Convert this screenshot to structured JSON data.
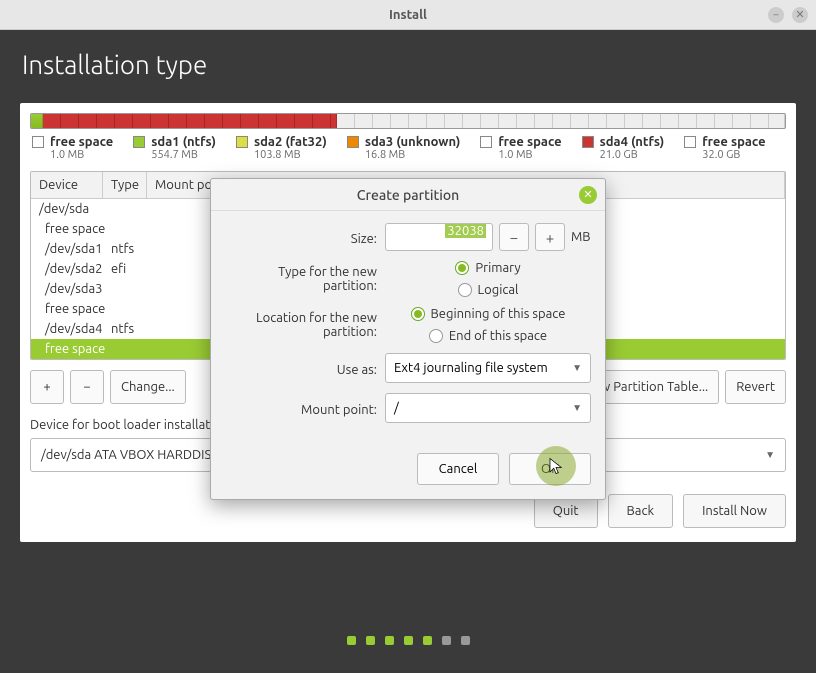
{
  "window": {
    "title": "Install"
  },
  "heading": "Installation type",
  "legend": [
    {
      "color": "lg-empty",
      "label": "free space",
      "sub": "1.0 MB"
    },
    {
      "color": "lg-green",
      "label": "sda1 (ntfs)",
      "sub": "554.7 MB"
    },
    {
      "color": "lg-yellow",
      "label": "sda2 (fat32)",
      "sub": "103.8 MB"
    },
    {
      "color": "lg-orange",
      "label": "sda3 (unknown)",
      "sub": "16.8 MB"
    },
    {
      "color": "lg-empty",
      "label": "free space",
      "sub": "1.0 MB"
    },
    {
      "color": "lg-red",
      "label": "sda4 (ntfs)",
      "sub": "21.0 GB"
    },
    {
      "color": "lg-empty",
      "label": "free space",
      "sub": "32.0 GB"
    }
  ],
  "table": {
    "headers": {
      "device": "Device",
      "type": "Type",
      "mount": "Mount point"
    },
    "rows": [
      {
        "device": "/dev/sda",
        "type": ""
      },
      {
        "device": "  free space",
        "type": ""
      },
      {
        "device": "  /dev/sda1",
        "type": "ntfs"
      },
      {
        "device": "  /dev/sda2",
        "type": "efi"
      },
      {
        "device": "  /dev/sda3",
        "type": ""
      },
      {
        "device": "  free space",
        "type": ""
      },
      {
        "device": "  /dev/sda4",
        "type": "ntfs"
      },
      {
        "device": "  free space",
        "type": "",
        "selected": true
      }
    ]
  },
  "toolbar": {
    "add": "+",
    "remove": "−",
    "change": "Change...",
    "newtbl": "New Partition Table...",
    "revert": "Revert"
  },
  "boot": {
    "label": "Device for boot loader installation:",
    "value": "/dev/sda   ATA VBOX HARDDISK (53.7 GB)"
  },
  "footer": {
    "quit": "Quit",
    "back": "Back",
    "install": "Install Now"
  },
  "modal": {
    "title": "Create partition",
    "size_label": "Size:",
    "size_value": "32038",
    "unit": "MB",
    "type_label": "Type for the new partition:",
    "type_primary": "Primary",
    "type_logical": "Logical",
    "loc_label": "Location for the new partition:",
    "loc_begin": "Beginning of this space",
    "loc_end": "End of this space",
    "use_label": "Use as:",
    "use_value": "Ext4 journaling file system",
    "mount_label": "Mount point:",
    "mount_value": "/",
    "cancel": "Cancel",
    "ok": "OK"
  }
}
